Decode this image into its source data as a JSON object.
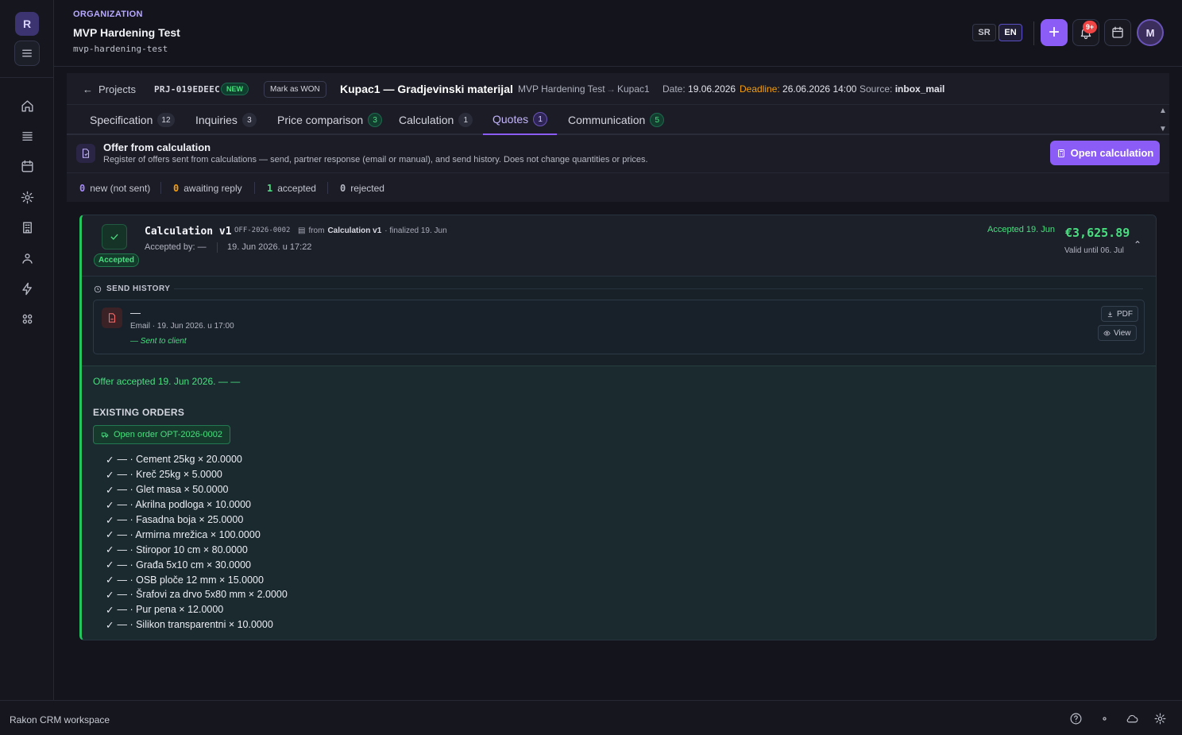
{
  "sidebar": {
    "logo_letter": "R"
  },
  "header": {
    "org_label": "ORGANIZATION",
    "org_name": "MVP Hardening Test",
    "org_slug": "mvp-hardening-test",
    "lang_sr": "SR",
    "lang_en": "EN",
    "add_label": "+",
    "notif_count": "9+",
    "avatar_initial": "M"
  },
  "project": {
    "back_label": "Projects",
    "code": "PRJ-019EDEEC",
    "status": "NEW",
    "mark_won": "Mark as WON",
    "title": "Kupac1 — Gradjevinski materijal",
    "org": "MVP Hardening Test",
    "arrow": "→",
    "customer": "Kupac1",
    "date_label": "Date:",
    "date_value": "19.06.2026",
    "deadline_label": "Deadline:",
    "deadline_value": "26.06.2026 14:00",
    "source_label": "Source:",
    "source_value": "inbox_mail"
  },
  "tabs": [
    {
      "label": "Specification",
      "count": "12"
    },
    {
      "label": "Inquiries",
      "count": "3"
    },
    {
      "label": "Price comparison",
      "count": "3"
    },
    {
      "label": "Calculation",
      "count": "1"
    },
    {
      "label": "Quotes",
      "count": "1"
    },
    {
      "label": "Communication",
      "count": "5"
    }
  ],
  "offer": {
    "title": "Offer from calculation",
    "description": "Register of offers sent from calculations — send, partner response (email or manual), and send history. Does not change quantities or prices.",
    "open_calc_label": "Open calculation",
    "stats": [
      {
        "num": "0",
        "label": "new (not sent)"
      },
      {
        "num": "0",
        "label": "awaiting reply"
      },
      {
        "num": "1",
        "label": "accepted"
      },
      {
        "num": "0",
        "label": "rejected"
      }
    ]
  },
  "quote": {
    "name": "Calculation v1",
    "code": "OFF-2026-0002",
    "from_prefix": "from",
    "from_calc": "Calculation v1",
    "finalized": "· finalized 19. Jun",
    "status_tag": "Accepted",
    "accepted_by": "Accepted by: —",
    "accepted_at": "19. Jun 2026. u 17:22",
    "accepted_on": "Accepted 19. Jun",
    "amount": "€3,625.89",
    "valid_until": "Valid until 06. Jul",
    "send_history_label": "SEND HISTORY",
    "history": {
      "recipient": "—",
      "meta": "Email · 19. Jun 2026. u 17:00",
      "status": "Sent to client",
      "pdf_label": "PDF",
      "view_label": "View"
    },
    "accepted_note": "Offer accepted 19. Jun 2026. — —",
    "existing_orders_label": "EXISTING ORDERS",
    "open_order_label": "Open order OPT-2026-0002",
    "order_lines": [
      "— · Cement 25kg × 20.0000",
      "— · Kreč 25kg × 5.0000",
      "— · Glet masa × 50.0000",
      "— · Akrilna podloga × 10.0000",
      "— · Fasadna boja × 25.0000",
      "— · Armirna mrežica × 100.0000",
      "— · Stiropor 10 cm × 80.0000",
      "— · Građa 5x10 cm × 30.0000",
      "— · OSB ploče 12 mm × 15.0000",
      "— · Šrafovi za drvo 5x80 mm × 2.0000",
      "— · Pur pena × 12.0000",
      "— · Silikon transparentni × 10.0000"
    ],
    "check_glyph": "✓"
  },
  "footer": {
    "workspace": "Rakon CRM workspace"
  },
  "colors": {
    "accent": "#8b5cf6",
    "success": "#4ade80",
    "warning": "#f59e0b",
    "danger": "#ef4444"
  }
}
